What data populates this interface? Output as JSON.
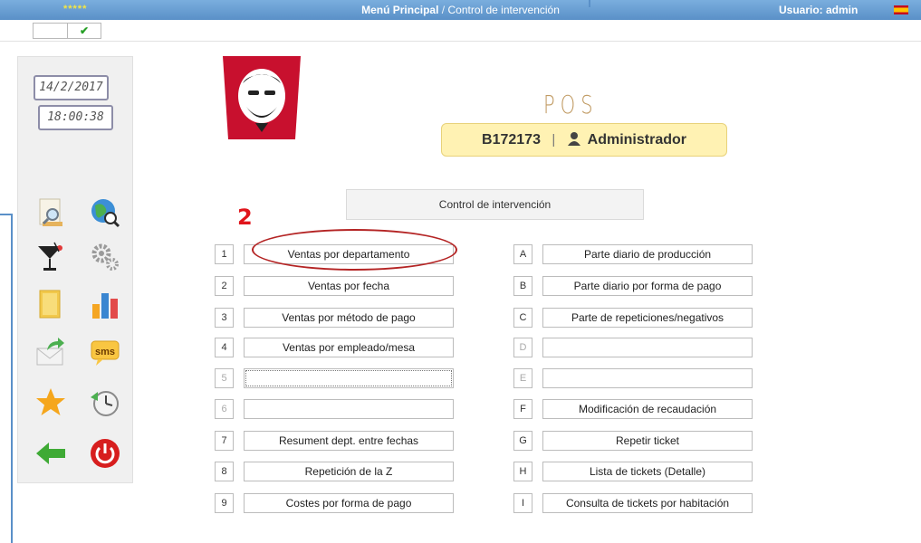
{
  "topbar": {
    "stars": "*****",
    "breadcrumb_root": "Menú Principal",
    "breadcrumb_sep": "/",
    "breadcrumb_current": "Control de intervención",
    "user": "Usuario: admin",
    "language_flag": "spain-flag-icon"
  },
  "checkbox": {
    "check": "✔"
  },
  "sidebar": {
    "date": "14/2/2017",
    "time": "18:00:38",
    "icons": [
      "search-document-icon",
      "globe-search-icon",
      "cocktail-icon",
      "gears-icon",
      "document-icon",
      "bar-chart-icon",
      "mail-forward-icon",
      "sms-icon",
      "star-icon",
      "clock-back-icon",
      "back-arrow-icon",
      "power-icon"
    ],
    "sms_label": "sms"
  },
  "header": {
    "pos_title": "POS",
    "code": "B172173",
    "separator": "|",
    "role": "Administrador"
  },
  "section": {
    "title": "Control de intervención"
  },
  "annotation": {
    "number": "2"
  },
  "menu": {
    "left": [
      {
        "key": "1",
        "label": "Ventas por departamento",
        "enabled": true
      },
      {
        "key": "2",
        "label": "Ventas por fecha",
        "enabled": true
      },
      {
        "key": "3",
        "label": "Ventas por método de pago",
        "enabled": true
      },
      {
        "key": "4",
        "label": "Ventas por empleado/mesa",
        "enabled": true
      },
      {
        "key": "5",
        "label": "",
        "enabled": false
      },
      {
        "key": "6",
        "label": "",
        "enabled": false
      },
      {
        "key": "7",
        "label": "Resument dept. entre fechas",
        "enabled": true
      },
      {
        "key": "8",
        "label": "Repetición de la Z",
        "enabled": true
      },
      {
        "key": "9",
        "label": "Costes por forma de pago",
        "enabled": true
      }
    ],
    "right": [
      {
        "key": "A",
        "label": "Parte diario de producción",
        "enabled": true
      },
      {
        "key": "B",
        "label": "Parte diario por forma de pago",
        "enabled": true
      },
      {
        "key": "C",
        "label": "Parte de repeticiones/negativos",
        "enabled": true
      },
      {
        "key": "D",
        "label": "",
        "enabled": false
      },
      {
        "key": "E",
        "label": "",
        "enabled": false
      },
      {
        "key": "F",
        "label": "Modificación de recaudación",
        "enabled": true
      },
      {
        "key": "G",
        "label": "Repetir ticket",
        "enabled": true
      },
      {
        "key": "H",
        "label": "Lista de tickets (Detalle)",
        "enabled": true
      },
      {
        "key": "I",
        "label": "Consulta de tickets por habitación",
        "enabled": true
      }
    ]
  }
}
